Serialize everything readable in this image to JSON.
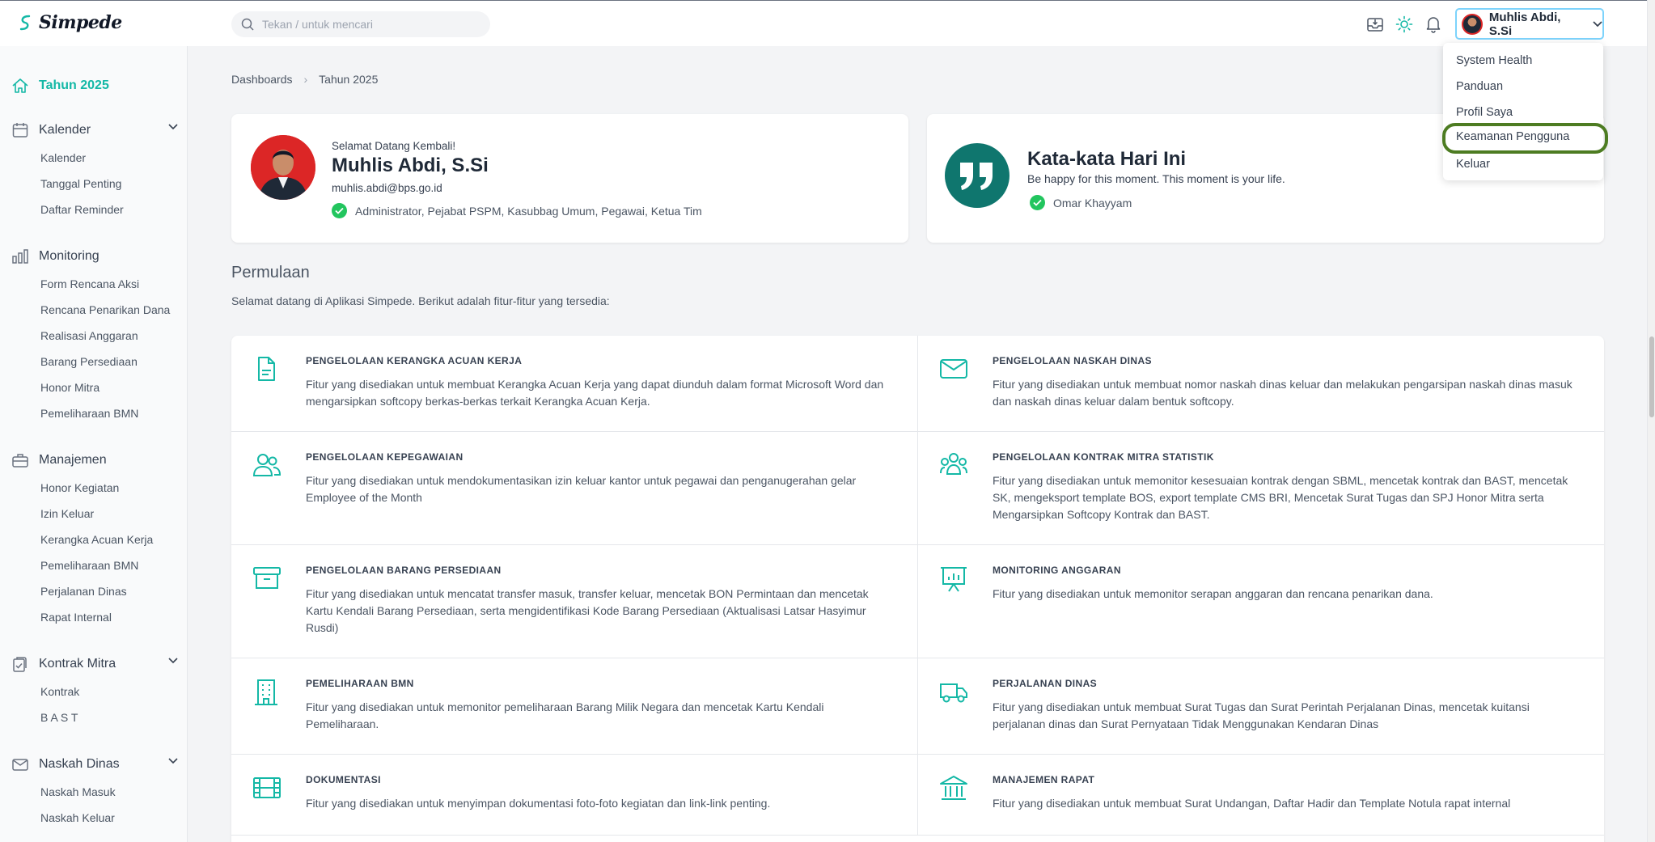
{
  "app": {
    "name": "Simpede"
  },
  "search": {
    "placeholder": "Tekan / untuk mencari"
  },
  "user": {
    "name": "Muhlis Abdi, S.Si",
    "email": "muhlis.abdi@bps.go.id",
    "welcome": "Selamat Datang Kembali!",
    "roles": "Administrator, Pejabat PSPM, Kasubbag Umum, Pegawai, Ketua Tim"
  },
  "user_menu": {
    "items": [
      "System Health",
      "Panduan",
      "Profil Saya",
      "Keamanan Pengguna",
      "Keluar"
    ],
    "highlighted": "Keamanan Pengguna"
  },
  "sidebar": {
    "year": "Tahun 2025",
    "groups": [
      {
        "label": "Kalender",
        "icon": "calendar-icon",
        "items": [
          "Kalender",
          "Tanggal Penting",
          "Daftar Reminder"
        ]
      },
      {
        "label": "Monitoring",
        "icon": "bar-chart-icon",
        "items": [
          "Form Rencana Aksi",
          "Rencana Penarikan Dana",
          "Realisasi Anggaran",
          "Barang Persediaan",
          "Honor Mitra",
          "Pemeliharaan BMN"
        ]
      },
      {
        "label": "Manajemen",
        "icon": "briefcase-icon",
        "items": [
          "Honor Kegiatan",
          "Izin Keluar",
          "Kerangka Acuan Kerja",
          "Pemeliharaan BMN",
          "Perjalanan Dinas",
          "Rapat Internal"
        ]
      },
      {
        "label": "Kontrak Mitra",
        "icon": "clipboard-check-icon",
        "items": [
          "Kontrak",
          "B A S T"
        ]
      },
      {
        "label": "Naskah Dinas",
        "icon": "mail-icon",
        "items": [
          "Naskah Masuk",
          "Naskah Keluar"
        ]
      }
    ]
  },
  "breadcrumb": [
    "Dashboards",
    "Tahun 2025"
  ],
  "quote": {
    "title": "Kata-kata Hari Ini",
    "text": "Be happy for this moment. This moment is your life.",
    "author": "Omar Khayyam"
  },
  "intro": {
    "title": "Permulaan",
    "subtitle": "Selamat datang di Aplikasi Simpede. Berikut adalah fitur-fitur yang tersedia:"
  },
  "features": [
    {
      "title": "PENGELOLAAN KERANGKA ACUAN KERJA",
      "desc": "Fitur yang disediakan untuk membuat Kerangka Acuan Kerja yang dapat diunduh dalam format Microsoft Word dan mengarsipkan softcopy berkas-berkas terkait Kerangka Acuan Kerja.",
      "icon": "document-icon"
    },
    {
      "title": "PENGELOLAAN NASKAH DINAS",
      "desc": "Fitur yang disediakan untuk membuat nomor naskah dinas keluar dan melakukan pengarsipan naskah dinas masuk dan naskah dinas keluar dalam bentuk softcopy.",
      "icon": "envelope-icon"
    },
    {
      "title": "PENGELOLAAN KEPEGAWAIAN",
      "desc": "Fitur yang disediakan untuk mendokumentasikan izin keluar kantor untuk pegawai dan penganugerahan gelar Employee of the Month",
      "icon": "users-icon"
    },
    {
      "title": "PENGELOLAAN KONTRAK MITRA STATISTIK",
      "desc": "Fitur yang disediakan untuk memonitor kesesuaian kontrak dengan SBML, mencetak kontrak dan BAST, mencetak SK, mengeksport template BOS, export template CMS BRI, Mencetak Surat Tugas dan SPJ Honor Mitra serta Mengarsipkan Softcopy Kontrak dan BAST.",
      "icon": "user-group-icon"
    },
    {
      "title": "PENGELOLAAN BARANG PERSEDIAAN",
      "desc": "Fitur yang disediakan untuk mencatat transfer masuk, transfer keluar, mencetak BON Permintaan dan mencetak Kartu Kendali Barang Persediaan, serta mengidentifikasi Kode Barang Persediaan (Aktualisasi Latsar Hasyimur Rusdi)",
      "icon": "archive-box-icon"
    },
    {
      "title": "MONITORING ANGGARAN",
      "desc": "Fitur yang disediakan untuk memonitor serapan anggaran dan rencana penarikan dana.",
      "icon": "presentation-chart-icon"
    },
    {
      "title": "PEMELIHARAAN BMN",
      "desc": "Fitur yang disediakan untuk memonitor pemeliharaan Barang Milik Negara dan mencetak Kartu Kendali Pemeliharaan.",
      "icon": "building-icon"
    },
    {
      "title": "PERJALANAN DINAS",
      "desc": "Fitur yang disediakan untuk membuat Surat Tugas dan Surat Perintah Perjalanan Dinas, mencetak kuitansi perjalanan dinas dan Surat Pernyataan Tidak Menggunakan Kendaran Dinas",
      "icon": "truck-icon"
    },
    {
      "title": "DOKUMENTASI",
      "desc": "Fitur yang disediakan untuk menyimpan dokumentasi foto-foto kegiatan dan link-link penting.",
      "icon": "film-icon"
    },
    {
      "title": "MANAJEMEN RAPAT",
      "desc": "Fitur yang disediakan untuk membuat Surat Undangan, Daftar Hadir dan Template Notula rapat internal",
      "icon": "bank-icon"
    }
  ],
  "colors": {
    "accent": "#14b8a6",
    "quote_badge": "#0f766e",
    "highlight_ring": "#4d7c22",
    "check": "#22c55e"
  }
}
